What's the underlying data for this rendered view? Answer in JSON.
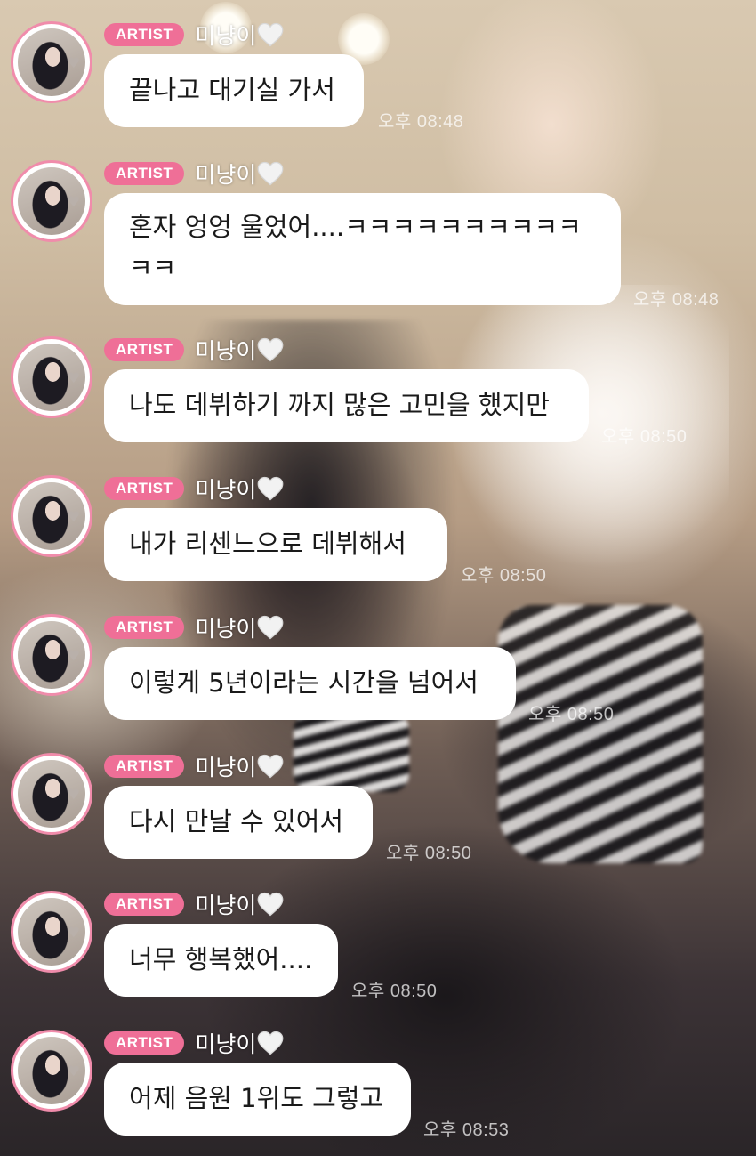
{
  "badge_label": "ARTIST",
  "messages": [
    {
      "nickname": "미냥이",
      "text": "끝나고 대기실 가서",
      "time": "오후 08:48"
    },
    {
      "nickname": "미냥이",
      "text": "혼자 엉엉 울었어....ㅋㅋㅋㅋㅋㅋㅋㅋㅋㅋㅋㅋ",
      "time": "오후 08:48"
    },
    {
      "nickname": "미냥이",
      "text": "나도 데뷔하기 까지 많은 고민을 했지만",
      "time": "오후 08:50"
    },
    {
      "nickname": "미냥이",
      "text": "내가 리센느으로 데뷔해서",
      "time": "오후 08:50"
    },
    {
      "nickname": "미냥이",
      "text": "이렇게 5년이라는 시간을 넘어서",
      "time": "오후 08:50"
    },
    {
      "nickname": "미냥이",
      "text": "다시 만날 수 있어서",
      "time": "오후 08:50"
    },
    {
      "nickname": "미냥이",
      "text": "너무 행복했어....",
      "time": "오후 08:50"
    },
    {
      "nickname": "미냥이",
      "text": "어제 음원 1위도 그렇고",
      "time": "오후 08:53"
    }
  ],
  "colors": {
    "badge": "#ef6f97",
    "avatar_ring": "#f08cab",
    "bubble": "#ffffff"
  }
}
